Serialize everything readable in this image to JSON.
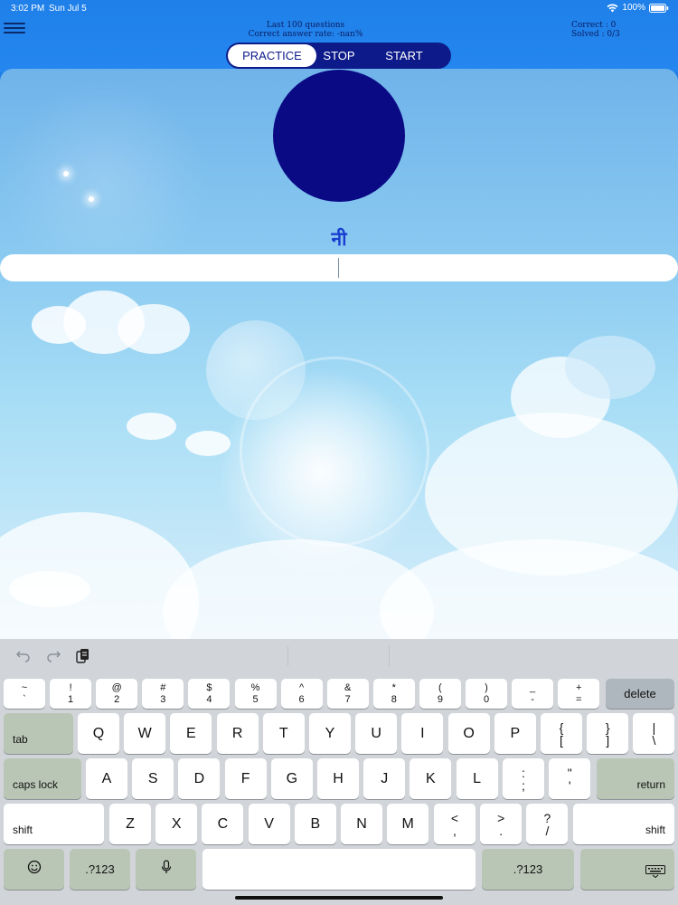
{
  "status": {
    "time": "3:02 PM",
    "date": "Sun Jul 5",
    "battery": "100%"
  },
  "stats": {
    "last_questions": "Last 100 questions",
    "correct_rate": "Correct answer rate: -nan%",
    "correct": "Correct : 0",
    "solved": "Solved : 0/3"
  },
  "modes": {
    "practice": "PRACTICE",
    "stop": "STOP",
    "start": "START"
  },
  "question": {
    "character": "नी",
    "answer_value": ""
  },
  "colors": {
    "circle": "#0b0a85",
    "segment_bg": "#0d1b8a"
  },
  "keyboard": {
    "row1": [
      [
        "~",
        "`"
      ],
      [
        "!",
        "1"
      ],
      [
        "@",
        "2"
      ],
      [
        "#",
        "3"
      ],
      [
        "$",
        "4"
      ],
      [
        "%",
        "5"
      ],
      [
        "^",
        "6"
      ],
      [
        "&",
        "7"
      ],
      [
        "*",
        "8"
      ],
      [
        "(",
        "9"
      ],
      [
        ")",
        "0"
      ],
      [
        "_",
        "-"
      ],
      [
        "+",
        "="
      ]
    ],
    "delete": "delete",
    "tab": "tab",
    "row2": [
      "Q",
      "W",
      "E",
      "R",
      "T",
      "Y",
      "U",
      "I",
      "O",
      "P"
    ],
    "row2_sym": [
      [
        "{",
        "["
      ],
      [
        "}",
        "]"
      ],
      [
        "|",
        "\\"
      ]
    ],
    "caps_lock": "caps lock",
    "row3": [
      "A",
      "S",
      "D",
      "F",
      "G",
      "H",
      "J",
      "K",
      "L"
    ],
    "row3_sym": [
      [
        ":",
        ";"
      ],
      [
        "\"",
        "'"
      ]
    ],
    "return": "return",
    "shift": "shift",
    "row4": [
      "Z",
      "X",
      "C",
      "V",
      "B",
      "N",
      "M"
    ],
    "row4_sym": [
      [
        "<",
        ","
      ],
      [
        ">",
        "."
      ],
      [
        "?",
        "/"
      ]
    ],
    "numbers_key": ".?123"
  }
}
